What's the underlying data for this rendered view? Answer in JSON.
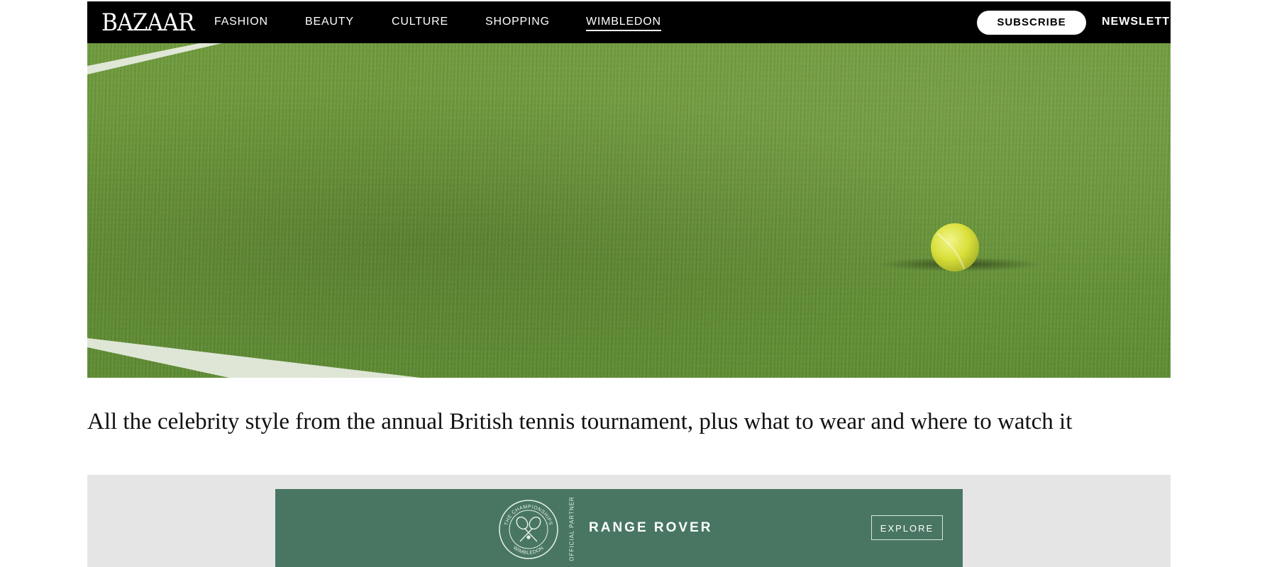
{
  "header": {
    "logo": "BAZAAR",
    "nav": [
      "FASHION",
      "BEAUTY",
      "CULTURE",
      "SHOPPING",
      "WIMBLEDON"
    ],
    "active_nav": "WIMBLEDON",
    "subscribe_label": "SUBSCRIBE",
    "newsletter_label": "NEWSLETT"
  },
  "article": {
    "dek": "All the celebrity style from the annual British tennis tournament, plus what to wear and where to watch it"
  },
  "ad": {
    "emblem_top": "THE CHAMPIONSHIPS",
    "emblem_bottom": "WIMBLEDON",
    "partner_label": "OFFICIAL PARTNER",
    "brand": "RANGE ROVER",
    "cta": "EXPLORE"
  },
  "colors": {
    "nav_bg": "#000000",
    "grass": "#6a9639",
    "ad_green": "#487663",
    "ad_frame": "#e5e5e5"
  }
}
